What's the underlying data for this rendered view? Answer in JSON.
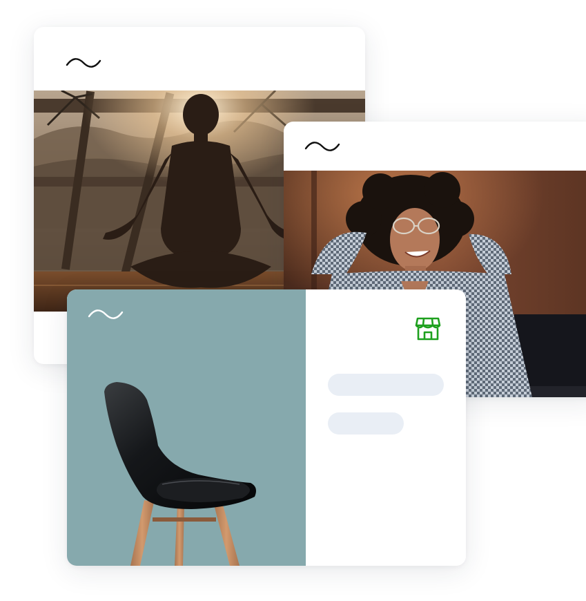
{
  "cards": [
    {
      "id": "yoga-card",
      "logo_icon": "wave-logo-icon",
      "image_subject": "person-meditating-photo"
    },
    {
      "id": "relax-card",
      "logo_icon": "wave-logo-icon",
      "image_subject": "smiling-woman-photo"
    },
    {
      "id": "product-card",
      "logo_icon": "wave-logo-icon",
      "image_subject": "black-chair-photo",
      "store_icon": "storefront-icon",
      "placeholder_lines": 2
    }
  ],
  "colors": {
    "card_bg": "#ffffff",
    "product_panel_bg": "#86a9ad",
    "store_icon": "#1ea01e",
    "skeleton": "#e9eef5",
    "logo_dark": "#111111",
    "logo_light": "#ffffff"
  }
}
